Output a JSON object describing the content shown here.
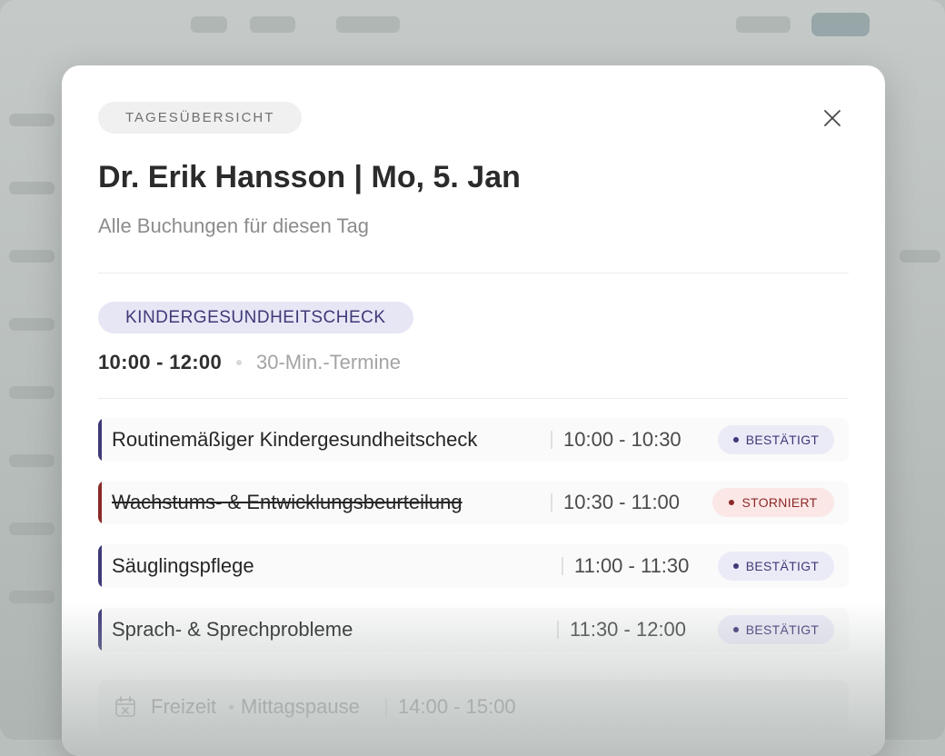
{
  "modal": {
    "tag": "TAGESÜBERSICHT",
    "title": "Dr. Erik Hansson | Mo, 5. Jan",
    "subtitle": "Alle Buchungen für diesen Tag",
    "close_icon": "close-icon"
  },
  "session": {
    "service": "KINDERGESUNDHEITSCHECK",
    "time_range": "10:00 - 12:00",
    "slot_length": "30-Min.-Termine"
  },
  "bookings": [
    {
      "name": "Routinemäßiger Kindergesundheitscheck",
      "time": "10:00 - 10:30",
      "status": "BESTÄTIGT",
      "cancelled": false
    },
    {
      "name": "Wachstums- & Entwicklungsbeurteilung",
      "time": "10:30 - 11:00",
      "status": "STORNIERT",
      "cancelled": true
    },
    {
      "name": "Säuglingspflege",
      "time": "11:00 - 11:30",
      "status": "BESTÄTIGT",
      "cancelled": false
    },
    {
      "name": "Sprach- & Sprechprobleme",
      "time": "11:30 - 12:00",
      "status": "BESTÄTIGT",
      "cancelled": false
    }
  ],
  "free_time": {
    "icon": "calendar-x-icon",
    "label": "Freizeit",
    "reason": "Mittagspause",
    "time": "14:00 - 15:00"
  },
  "colors": {
    "confirmed_accent": "#3e3a78",
    "cancelled_accent": "#8b2a28",
    "confirmed_bg": "#ebeaf7",
    "cancelled_bg": "#fbe7e6"
  }
}
